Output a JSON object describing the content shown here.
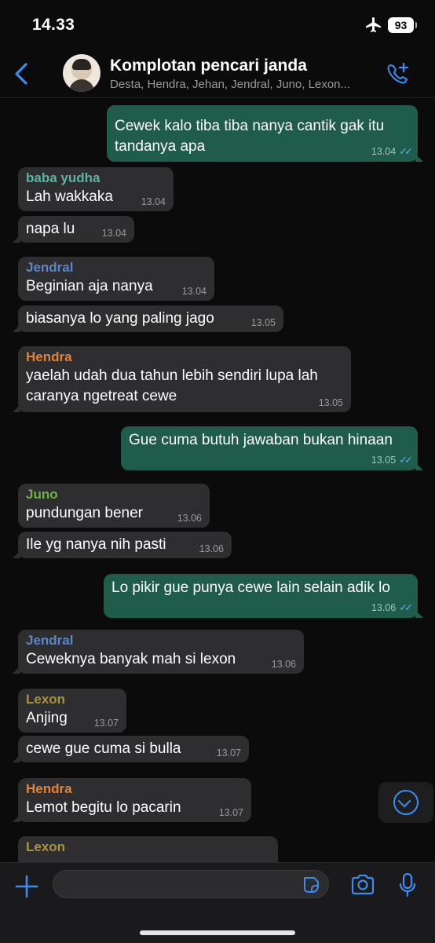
{
  "status_bar": {
    "time": "14.33",
    "battery": "93"
  },
  "header": {
    "title": "Komplotan pencari janda",
    "subtitle": "Desta, Hendra, Jehan, Jendral, Juno, Lexon..."
  },
  "colors": {
    "incoming_bubble": "#2e2e30",
    "outgoing_bubble": "#1f5c4b",
    "accent": "#3b8ef0",
    "sender_baba": "#5fb3a2",
    "sender_jendral": "#5a86c8",
    "sender_hendra": "#e2833a",
    "sender_juno": "#6fb04a",
    "sender_lexon": "#a8923a"
  },
  "messages": [
    {
      "text": "Cewek kalo tiba tiba nanya cantik gak itu tandanya apa",
      "time": "13.04"
    },
    {
      "sender": "baba yudha",
      "text": "Lah wakkaka",
      "time": "13.04"
    },
    {
      "text": "napa lu",
      "time": "13.04"
    },
    {
      "sender": "Jendral",
      "text": "Beginian aja nanya",
      "time": "13.04"
    },
    {
      "text": "biasanya lo yang paling jago",
      "time": "13.05"
    },
    {
      "sender": "Hendra",
      "text": "yaelah udah dua tahun lebih sendiri lupa lah caranya ngetreat cewe",
      "time": "13.05"
    },
    {
      "text": "Gue cuma butuh jawaban bukan hinaan",
      "time": "13.05"
    },
    {
      "sender": "Juno",
      "text": "pundungan bener",
      "time": "13.06"
    },
    {
      "text": "Ile yg nanya nih pasti",
      "time": "13.06"
    },
    {
      "text": "Lo pikir gue punya cewe lain selain adik lo",
      "time": "13.06"
    },
    {
      "sender": "Jendral",
      "text": "Ceweknya banyak mah si lexon",
      "time": "13.06"
    },
    {
      "sender": "Lexon",
      "text": "Anjing",
      "time": "13.07"
    },
    {
      "text": "cewe gue cuma si bulla",
      "time": "13.07"
    },
    {
      "sender": "Hendra",
      "text": "Lemot begitu lo pacarin",
      "time": "13.07"
    },
    {
      "sender": "Lexon"
    }
  ],
  "input": {
    "value": ""
  }
}
